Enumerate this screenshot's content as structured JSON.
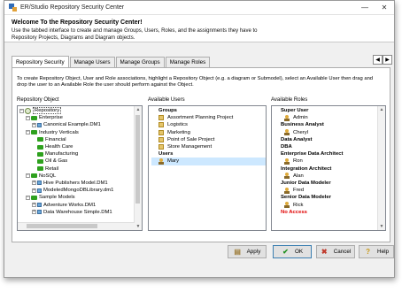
{
  "window": {
    "title": "ER/Studio Repository Security Center",
    "minimize": "—",
    "close": "✕"
  },
  "header": {
    "heading": "Welcome To the Repository Security Center!",
    "description": "Use the tabbed interface to create and manage Groups, Users, Roles, and the assignments they have to Repository Projects, Diagrams and Diagram objects."
  },
  "tabs": [
    {
      "label": "Repository Security",
      "active": true
    },
    {
      "label": "Manage Users"
    },
    {
      "label": "Manage Groups"
    },
    {
      "label": "Manage Roles"
    }
  ],
  "tab_nav": {
    "prev": "◀",
    "next": "▶"
  },
  "panel": {
    "instructions": "To create Repository Object, User and Role associations, highlight a Repository Object (e.g. a diagram or Submodel), select an Available User then drag and drop the user to an Available Role the user should perform against the Object.",
    "repository_label": "Repository Object",
    "users_label": "Available Users",
    "roles_label": "Available Roles"
  },
  "repository_tree": [
    {
      "label": "Repository",
      "icon": "repository-icon",
      "pm": "−",
      "level": 0
    },
    {
      "label": "Enterprise",
      "icon": "folder-icon",
      "pm": "−",
      "level": 1
    },
    {
      "label": "Canonical Example.DM1",
      "icon": "model-icon",
      "pm": "+",
      "level": 2
    },
    {
      "label": "Industry Verticals",
      "icon": "folder-icon",
      "pm": "−",
      "level": 1
    },
    {
      "label": "Financial",
      "icon": "folder-icon",
      "level": 2
    },
    {
      "label": "Health Care",
      "icon": "folder-icon",
      "level": 2
    },
    {
      "label": "Manufacturing",
      "icon": "folder-icon",
      "level": 2
    },
    {
      "label": "Oil & Gas",
      "icon": "folder-icon",
      "level": 2
    },
    {
      "label": "Retail",
      "icon": "folder-icon",
      "level": 2
    },
    {
      "label": "NoSQL",
      "icon": "folder-icon",
      "pm": "−",
      "level": 1
    },
    {
      "label": "Hive Publishers Model.DM1",
      "icon": "model-icon",
      "pm": "+",
      "level": 2
    },
    {
      "label": "ModeledMongoDBLibrary.dm1",
      "icon": "model-icon",
      "pm": "+",
      "level": 2
    },
    {
      "label": "Sample Models",
      "icon": "folder-icon",
      "pm": "−",
      "level": 1
    },
    {
      "label": "Adventure Works.DM1",
      "icon": "model-icon",
      "pm": "+",
      "level": 2
    },
    {
      "label": "Data Warehouse Simple.DM1",
      "icon": "model-icon",
      "pm": "+",
      "level": 2
    }
  ],
  "available_users": {
    "groups_heading": "Groups",
    "groups": [
      "Assortment Planning Project",
      "Logistics",
      "Marketing",
      "Point of Sale Project",
      "Store Management"
    ],
    "users_heading": "Users",
    "users": [
      "Mary"
    ]
  },
  "available_roles": [
    {
      "role": "Super User",
      "users": [
        "Admin"
      ]
    },
    {
      "role": "Business Analyst",
      "users": [
        "Cheryl"
      ]
    },
    {
      "role": "Data Analyst",
      "users": []
    },
    {
      "role": "DBA",
      "users": []
    },
    {
      "role": "Enterprise Data Architect",
      "users": [
        "Ron"
      ]
    },
    {
      "role": "Integration Architect",
      "users": [
        "Alan"
      ]
    },
    {
      "role": "Junior Data Modeler",
      "users": [
        "Fred"
      ]
    },
    {
      "role": "Senior Data Modeler",
      "users": [
        "Rick"
      ]
    },
    {
      "role": "No Access",
      "users": [],
      "color": "#e00000"
    }
  ],
  "buttons": {
    "apply": "Apply",
    "ok": "OK",
    "cancel": "Cancel",
    "help": "Help"
  },
  "colors": {
    "no_access": "#e00000",
    "ok_check": "#1e8f1e",
    "cancel_x": "#c0392b",
    "selection": "#cde8ff"
  }
}
